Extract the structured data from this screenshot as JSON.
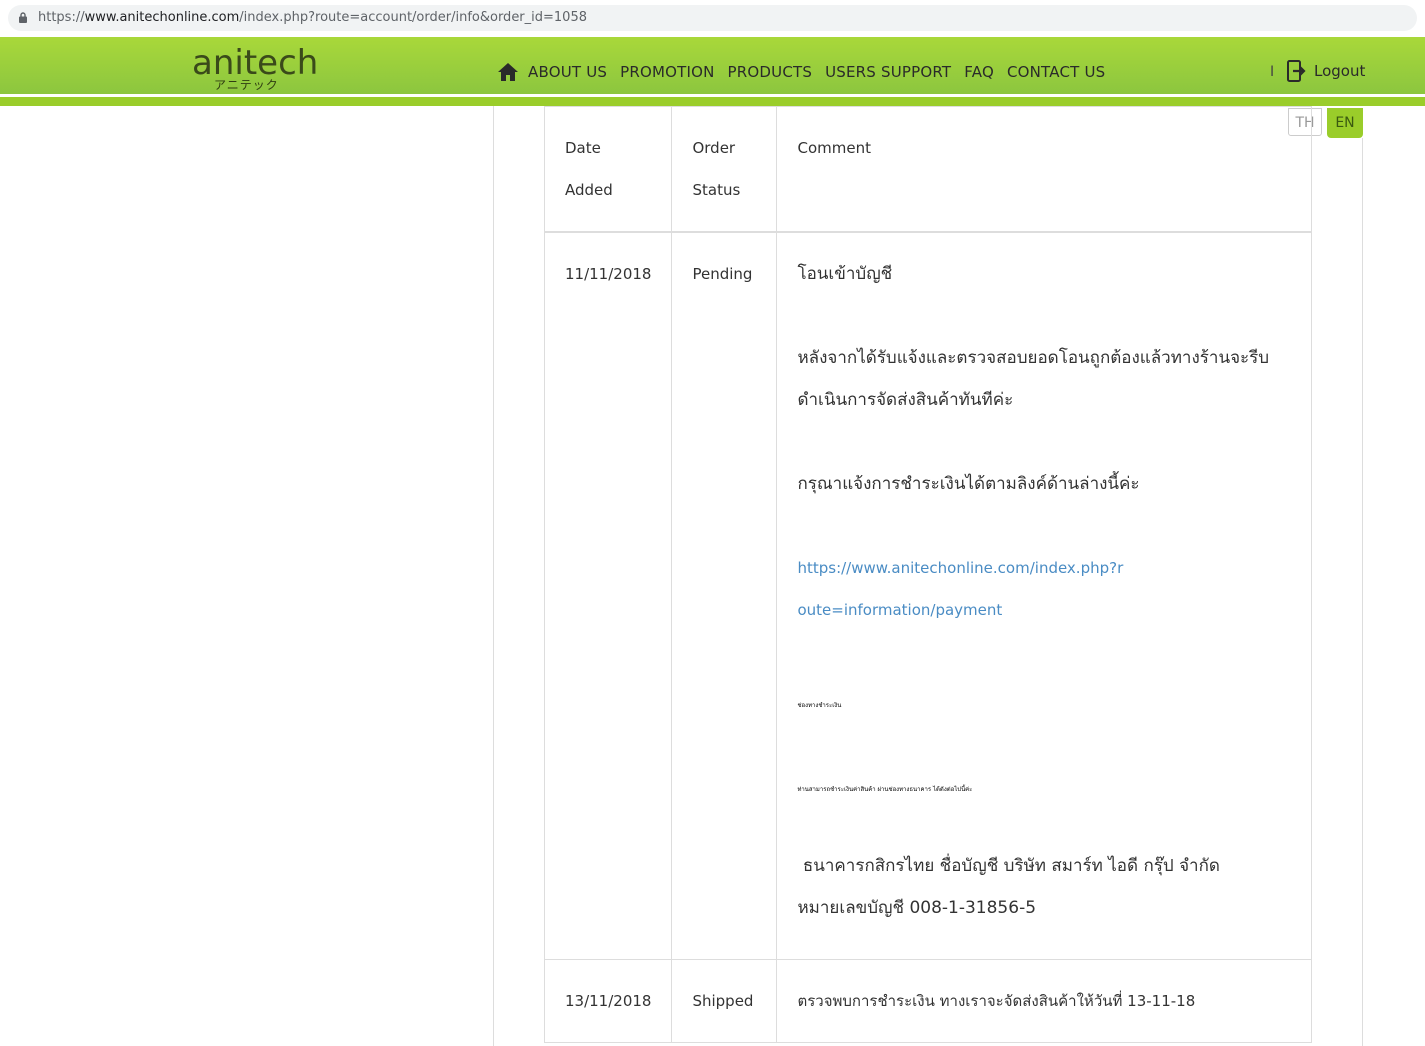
{
  "browser": {
    "url_prefix": "https://",
    "url_host": "www.anitechonline.com",
    "url_path": "/index.php?route=account/order/info&order_id=1058"
  },
  "header": {
    "logo": "anitech",
    "logo_sub": "アニテック",
    "nav": [
      "ABOUT US",
      "PROMOTION",
      "PRODUCTS",
      "USERS SUPPORT",
      "FAQ",
      "CONTACT US"
    ],
    "separator": "I",
    "logout": "Logout"
  },
  "language": {
    "th": "TH",
    "en": "EN"
  },
  "history": {
    "headers": {
      "date_line1": "Date",
      "date_line2": "Added",
      "status_line1": "Order",
      "status_line2": "Status",
      "comment": "Comment"
    },
    "rows": [
      {
        "date": "11/11/2018",
        "status": "Pending",
        "comment": {
          "p1": "โอนเข้าบัญชี",
          "p2": "หลังจากได้รับแจ้งและตรวจสอบยอดโอนถูกต้องแล้วทางร้านจะรีบดำเนินการจัดส่งสินค้าทันทีค่ะ",
          "p3": "กรุณาแจ้งการชำระเงินได้ตามลิงค์ด้านล่างนี้ค่ะ",
          "link": "https://www.anitechonline.com/index.php?route=information/payment",
          "tiny1": "ช่องทางชำระเงิน",
          "tiny2": "ท่านสามารถชำระเงินค่าสินค้า ผ่านช่องทางธนาคาร ได้ดังต่อไปนี้ค่ะ",
          "bank": " ธนาคารกสิกรไทย ชื่อบัญชี บริษัท สมาร์ท ไอดี กรุ๊ป จำกัด หมายเลขบัญชี 008-1-31856-5"
        }
      },
      {
        "date": "13/11/2018",
        "status": "Shipped",
        "comment": "ตรวจพบการชำระเงิน ทางเราจะจัดส่งสินค้าให้วันที่ 13-11-18"
      }
    ]
  }
}
